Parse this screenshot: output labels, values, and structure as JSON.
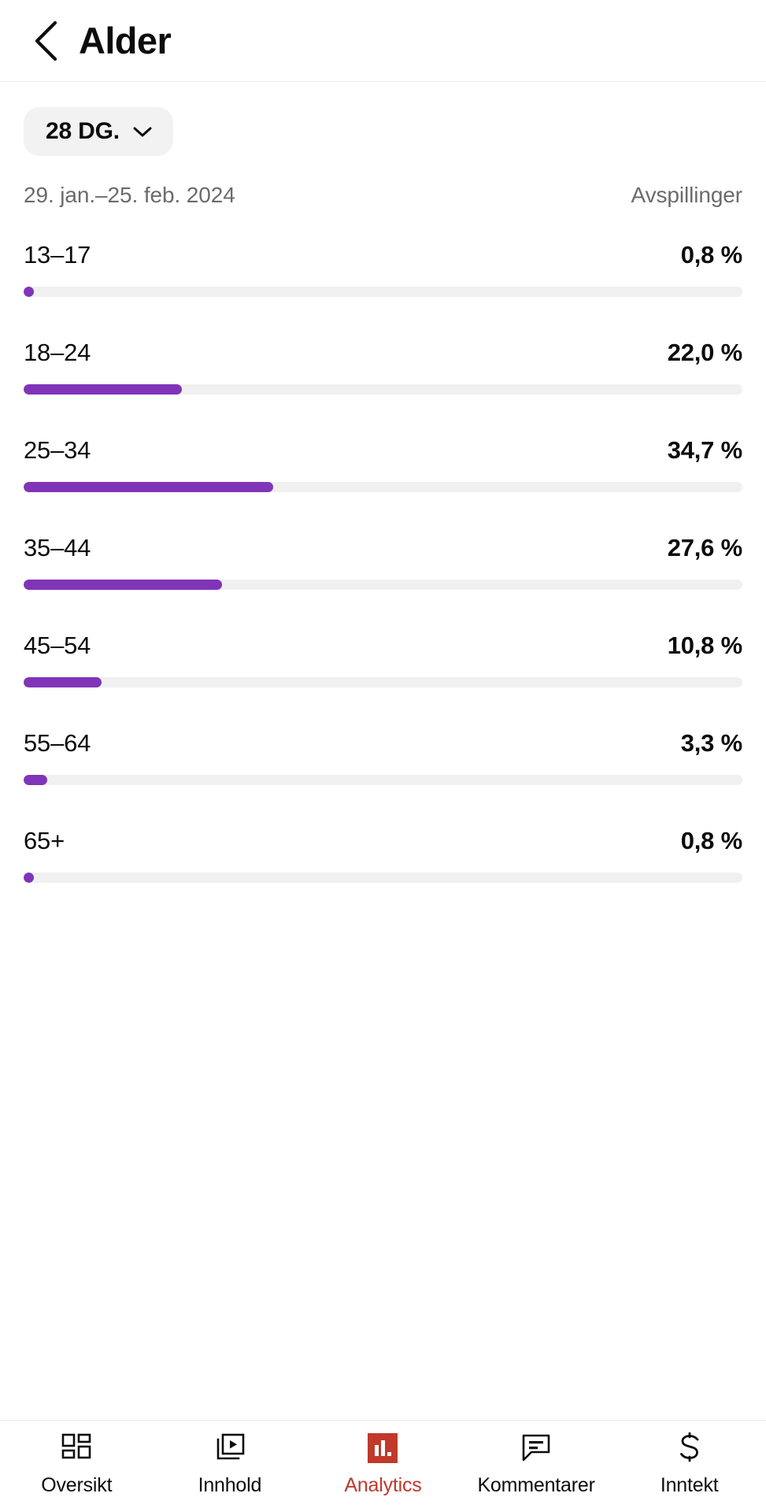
{
  "header": {
    "title": "Alder",
    "back_icon": "chevron-left-icon"
  },
  "filter": {
    "chip_label": "28 DG.",
    "chip_icon": "chevron-down-icon"
  },
  "meta": {
    "date_range": "29. jan.–25. feb. 2024",
    "metric_label": "Avspillinger"
  },
  "colors": {
    "bar_fill": "#8034b8",
    "bar_track": "#f0f0f0",
    "accent_active": "#c0392b",
    "text_primary": "#0c0c0c",
    "text_secondary": "#6b6b6b"
  },
  "chart_data": {
    "type": "bar",
    "title": "Alder",
    "subtitle": "29. jan.–25. feb. 2024",
    "xlabel": "",
    "ylabel": "Avspillinger",
    "unit": "%",
    "orientation": "horizontal",
    "grid": false,
    "legend": "none",
    "xlim": [
      0,
      100
    ],
    "categories": [
      "13–17",
      "18–24",
      "25–34",
      "35–44",
      "45–54",
      "55–64",
      "65+"
    ],
    "values": [
      0.8,
      22.0,
      34.7,
      27.6,
      10.8,
      3.3,
      0.8
    ],
    "value_labels": [
      "0,8 %",
      "22,0 %",
      "34,7 %",
      "27,6 %",
      "10,8 %",
      "3,3 %",
      "0,8 %"
    ]
  },
  "rows": [
    {
      "label": "13–17",
      "value_label": "0,8 %",
      "pct": 0.8
    },
    {
      "label": "18–24",
      "value_label": "22,0 %",
      "pct": 22.0
    },
    {
      "label": "25–34",
      "value_label": "34,7 %",
      "pct": 34.7
    },
    {
      "label": "35–44",
      "value_label": "27,6 %",
      "pct": 27.6
    },
    {
      "label": "45–54",
      "value_label": "10,8 %",
      "pct": 10.8
    },
    {
      "label": "55–64",
      "value_label": "3,3 %",
      "pct": 3.3
    },
    {
      "label": "65+",
      "value_label": "0,8 %",
      "pct": 0.8
    }
  ],
  "bottom_nav": {
    "active_index": 2,
    "items": [
      {
        "label": "Oversikt",
        "icon": "dashboard-grid-icon"
      },
      {
        "label": "Innhold",
        "icon": "video-stack-icon"
      },
      {
        "label": "Analytics",
        "icon": "bar-chart-icon"
      },
      {
        "label": "Kommentarer",
        "icon": "comment-bubble-icon"
      },
      {
        "label": "Inntekt",
        "icon": "dollar-sign-icon"
      }
    ]
  }
}
